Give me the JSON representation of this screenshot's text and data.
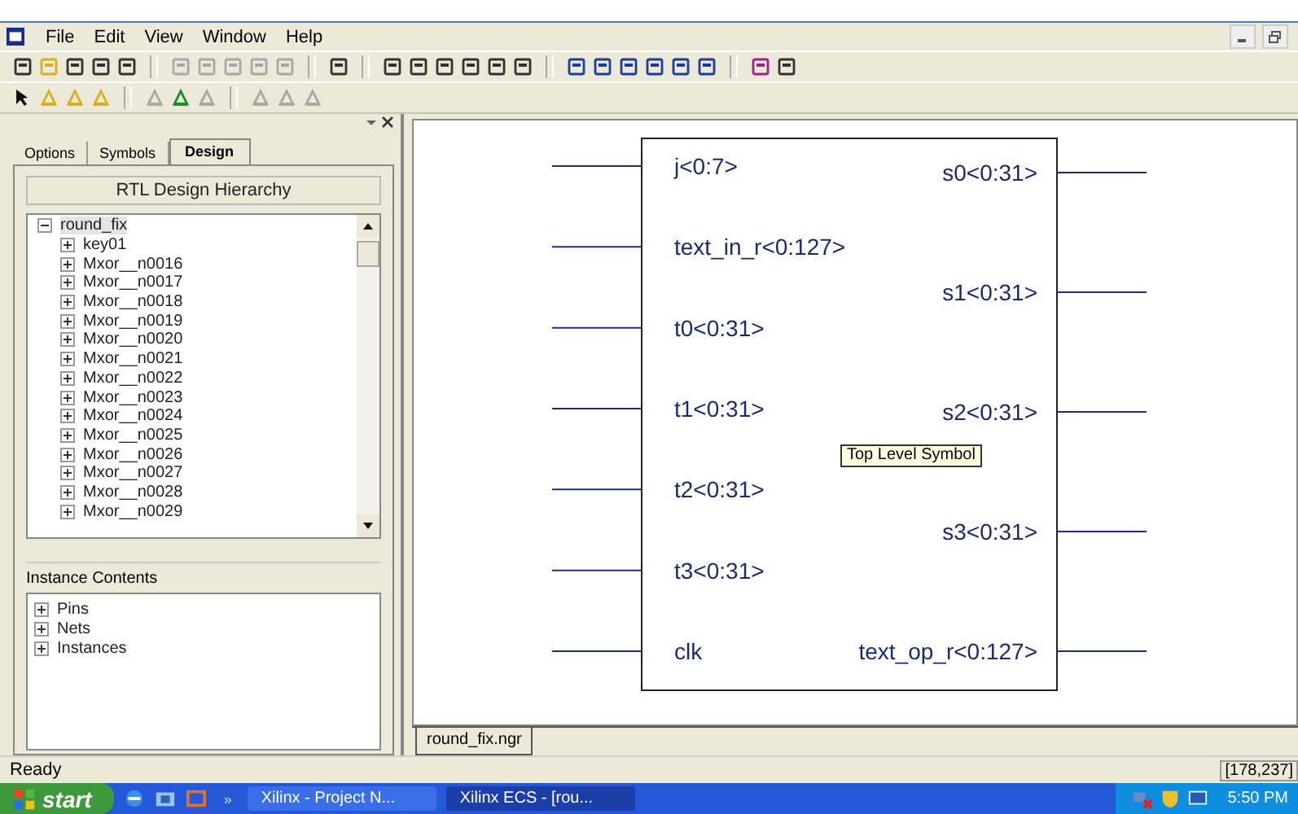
{
  "menu": [
    "File",
    "Edit",
    "View",
    "Window",
    "Help"
  ],
  "tabs": [
    {
      "label": "Options",
      "selected": false
    },
    {
      "label": "Symbols",
      "selected": false
    },
    {
      "label": "Design",
      "selected": true
    }
  ],
  "hierarchy": {
    "title": "RTL Design Hierarchy",
    "tree": [
      {
        "label": "round_fix",
        "expanded": true,
        "selected": true,
        "children": [
          {
            "label": "key01",
            "expanded": false,
            "selected": false
          },
          {
            "label": "Mxor__n0016",
            "expanded": false,
            "selected": false
          },
          {
            "label": "Mxor__n0017",
            "expanded": false,
            "selected": false
          },
          {
            "label": "Mxor__n0018",
            "expanded": false,
            "selected": false
          },
          {
            "label": "Mxor__n0019",
            "expanded": false,
            "selected": false
          },
          {
            "label": "Mxor__n0020",
            "expanded": false,
            "selected": false
          },
          {
            "label": "Mxor__n0021",
            "expanded": false,
            "selected": false
          },
          {
            "label": "Mxor__n0022",
            "expanded": false,
            "selected": false
          },
          {
            "label": "Mxor__n0023",
            "expanded": false,
            "selected": false
          },
          {
            "label": "Mxor__n0024",
            "expanded": false,
            "selected": false
          },
          {
            "label": "Mxor__n0025",
            "expanded": false,
            "selected": false
          },
          {
            "label": "Mxor__n0026",
            "expanded": false,
            "selected": false
          },
          {
            "label": "Mxor__n0027",
            "expanded": false,
            "selected": false
          },
          {
            "label": "Mxor__n0028",
            "expanded": false,
            "selected": false
          },
          {
            "label": "Mxor__n0029",
            "expanded": false,
            "selected": false
          }
        ]
      }
    ]
  },
  "instance_contents": {
    "title": "Instance Contents",
    "items": [
      {
        "label": "Pins",
        "expanded": false
      },
      {
        "label": "Nets",
        "expanded": false
      },
      {
        "label": "Instances",
        "expanded": false
      }
    ]
  },
  "symbol": {
    "left_pins": [
      "j<0:7>",
      "text_in_r<0:127>",
      "t0<0:31>",
      "t1<0:31>",
      "t2<0:31>",
      "t3<0:31>",
      "clk"
    ],
    "right_pins": [
      "s0<0:31>",
      "s1<0:31>",
      "s2<0:31>",
      "s3<0:31>",
      "text_op_r<0:127>"
    ],
    "tooltip": "Top Level Symbol"
  },
  "document_tabs": [
    {
      "label": "round_fix.ngr"
    }
  ],
  "status_bar": {
    "message": "Ready",
    "coordinates": "[178,237]"
  },
  "taskbar": {
    "start": "start",
    "more": "»",
    "tasks": [
      {
        "label": "Xilinx - Project N...",
        "selected": false
      },
      {
        "label": "Xilinx ECS - [rou...",
        "selected": true
      }
    ],
    "clock": "5:50 PM"
  }
}
